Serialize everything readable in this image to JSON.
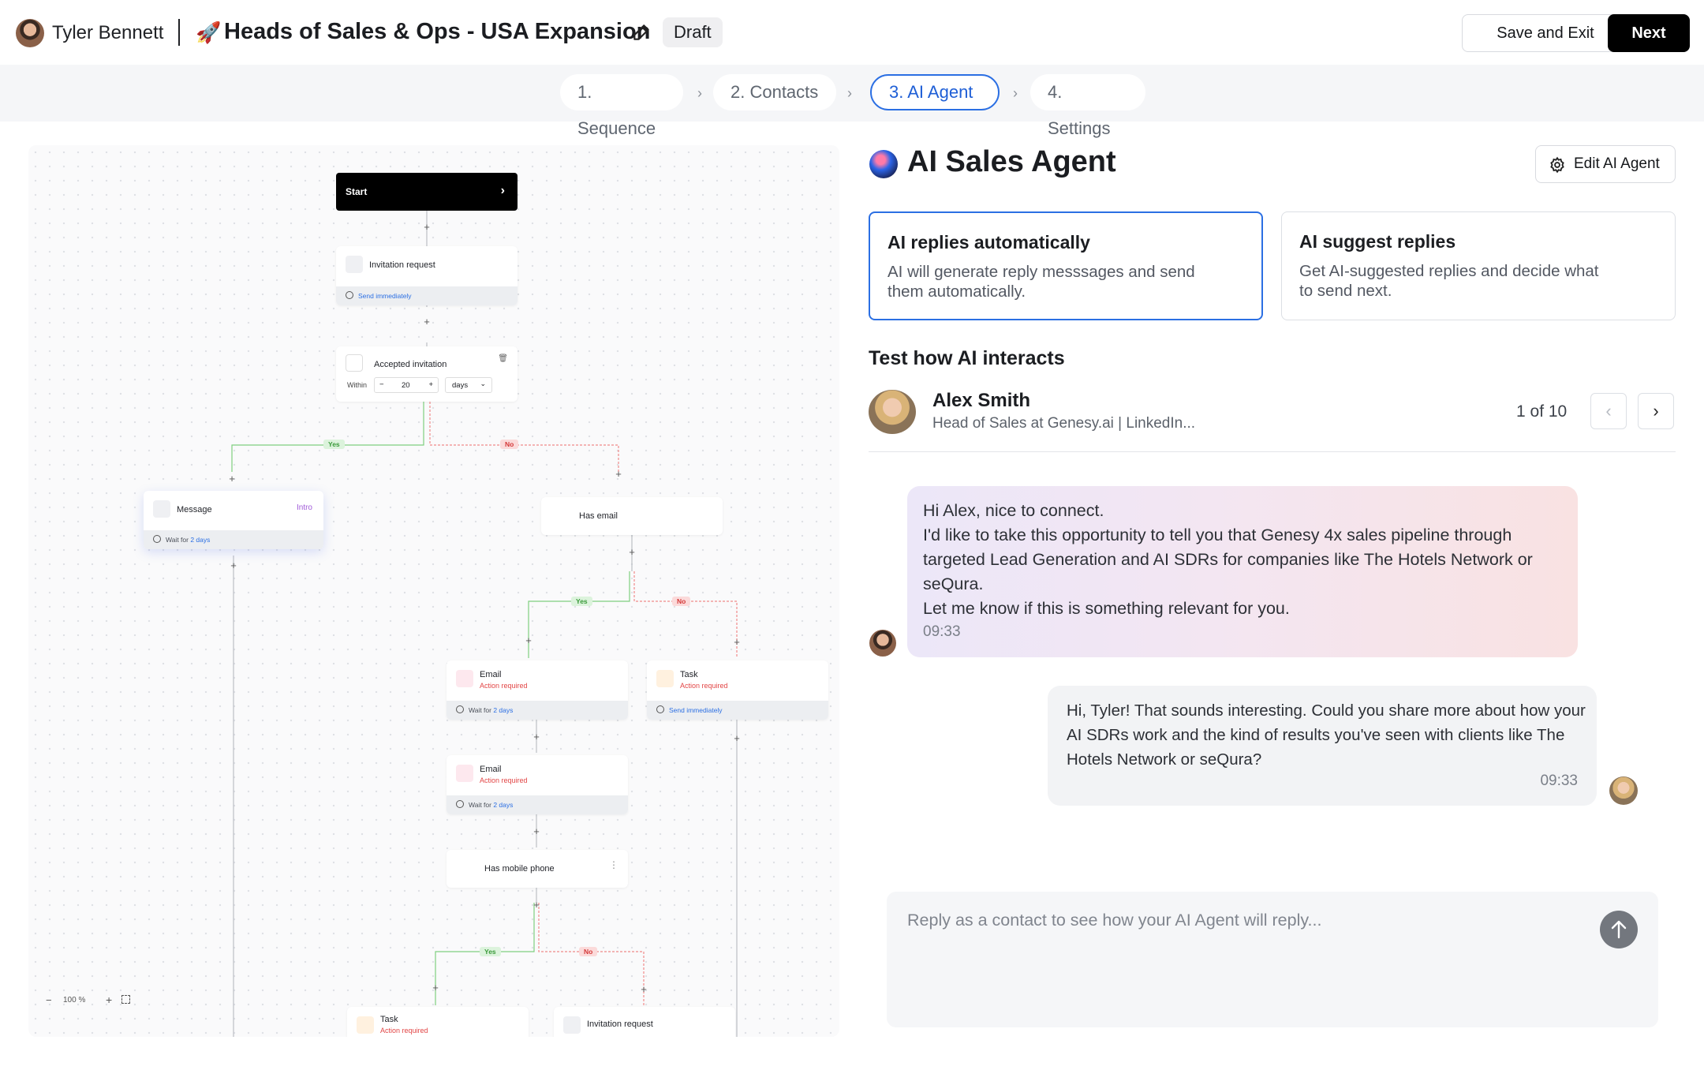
{
  "header": {
    "user_name": "Tyler Bennett",
    "campaign_emoji": "🚀",
    "campaign_title": "Heads of Sales & Ops - USA Expansion",
    "status_badge": "Draft",
    "save_exit_label": "Save and Exit",
    "next_label": "Next"
  },
  "steps": [
    {
      "label": "1. Sequence",
      "active": false
    },
    {
      "label": "2. Contacts",
      "active": false
    },
    {
      "label": "3. AI Agent",
      "active": true
    },
    {
      "label": "4. Settings",
      "active": false
    }
  ],
  "flow": {
    "start_label": "Start",
    "invitation_1": {
      "title": "Invitation request",
      "footer": "Send immediately"
    },
    "accepted": {
      "title": "Accepted invitation",
      "within_label": "Within",
      "value": "20",
      "unit": "days"
    },
    "message": {
      "title": "Message",
      "tag": "Intro",
      "footer_prefix": "Wait for",
      "footer_value": "2 days"
    },
    "has_email": {
      "title": "Has email"
    },
    "email_1": {
      "title": "Email",
      "sub": "Action required",
      "footer_prefix": "Wait for",
      "footer_value": "2 days"
    },
    "task_1": {
      "title": "Task",
      "sub": "Action required",
      "footer": "Send immediately"
    },
    "email_2": {
      "title": "Email",
      "sub": "Action required",
      "footer_prefix": "Wait for",
      "footer_value": "2 days"
    },
    "has_phone": {
      "title": "Has mobile phone"
    },
    "task_2": {
      "title": "Task",
      "sub": "Action required"
    },
    "invitation_2": {
      "title": "Invitation request"
    },
    "yes_label": "Yes",
    "no_label": "No",
    "zoom_level": "100 %"
  },
  "agent": {
    "title": "AI Sales Agent",
    "edit_label": "Edit AI Agent",
    "mode_auto": {
      "title": "AI replies automatically",
      "desc": "AI will generate reply messsages and send them automatically.",
      "selected": true
    },
    "mode_suggest": {
      "title": "AI suggest replies",
      "desc": "Get AI-suggested replies and decide what to send next.",
      "selected": false
    },
    "test_heading": "Test how AI interacts",
    "contact": {
      "name": "Alex Smith",
      "role": "Head of Sales at Genesy.ai | LinkedIn...",
      "counter": "1 of 10"
    },
    "messages": [
      {
        "from": "Tyler Bennett",
        "text": "Hi Alex, nice to connect.\nI'd like to take this opportunity to tell you that Genesy 4x sales pipeline through targeted Lead Generation and AI SDRs for companies like The Hotels Network or seQura.\nLet me know if this is something relevant for you.",
        "time": "09:33"
      },
      {
        "from": "Alex Smith",
        "text": "Hi, Tyler! That sounds interesting. Could you share more about how your AI SDRs work and the kind of results you've seen with clients like The Hotels Network or seQura?",
        "time": "09:33"
      }
    ],
    "reply_placeholder": "Reply as a contact to see how your AI Agent will reply..."
  },
  "colors": {
    "accent": "#2b6fe3",
    "yes": "#3a9a3a",
    "no": "#d43a3a",
    "action_required": "#e24545"
  }
}
